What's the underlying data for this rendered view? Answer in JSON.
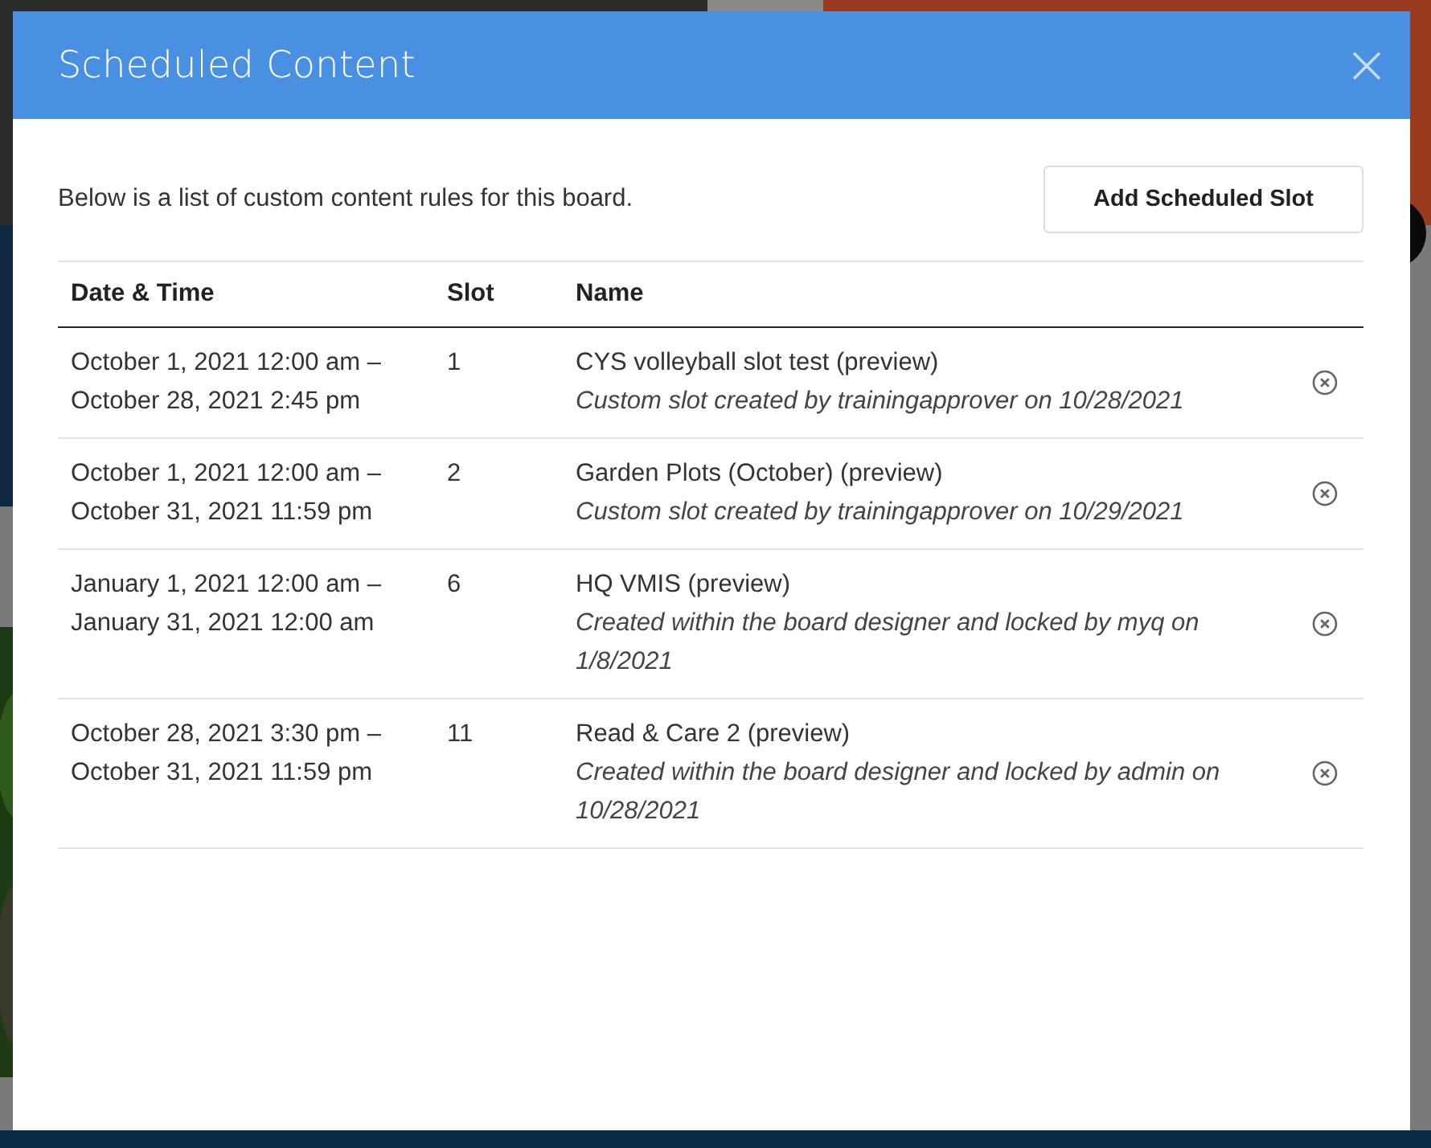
{
  "dialog": {
    "title": "Scheduled Content",
    "intro": "Below is a list of custom content rules for this board.",
    "add_button": "Add Scheduled Slot"
  },
  "table": {
    "columns": [
      "Date & Time",
      "Slot",
      "Name"
    ],
    "rows": [
      {
        "date_start": "October 1, 2021 12:00 am –",
        "date_end": "October 28, 2021 2:45 pm",
        "slot": "1",
        "name": "CYS volleyball slot test (preview)",
        "note": "Custom slot created by trainingapprover on 10/28/2021"
      },
      {
        "date_start": "October 1, 2021 12:00 am –",
        "date_end": "October 31, 2021 11:59 pm",
        "slot": "2",
        "name": "Garden Plots (October) (preview)",
        "note": "Custom slot created by trainingapprover on 10/29/2021"
      },
      {
        "date_start": "January 1, 2021 12:00 am –",
        "date_end": "January 31, 2021 12:00 am",
        "slot": "6",
        "name": "HQ VMIS (preview)",
        "note": "Created within the board designer and locked by myq on 1/8/2021"
      },
      {
        "date_start": "October 28, 2021 3:30 pm –",
        "date_end": "October 31, 2021 11:59 pm",
        "slot": "11",
        "name": "Read & Care 2 (preview)",
        "note": "Created within the board designer and locked by admin on 10/28/2021"
      }
    ]
  }
}
